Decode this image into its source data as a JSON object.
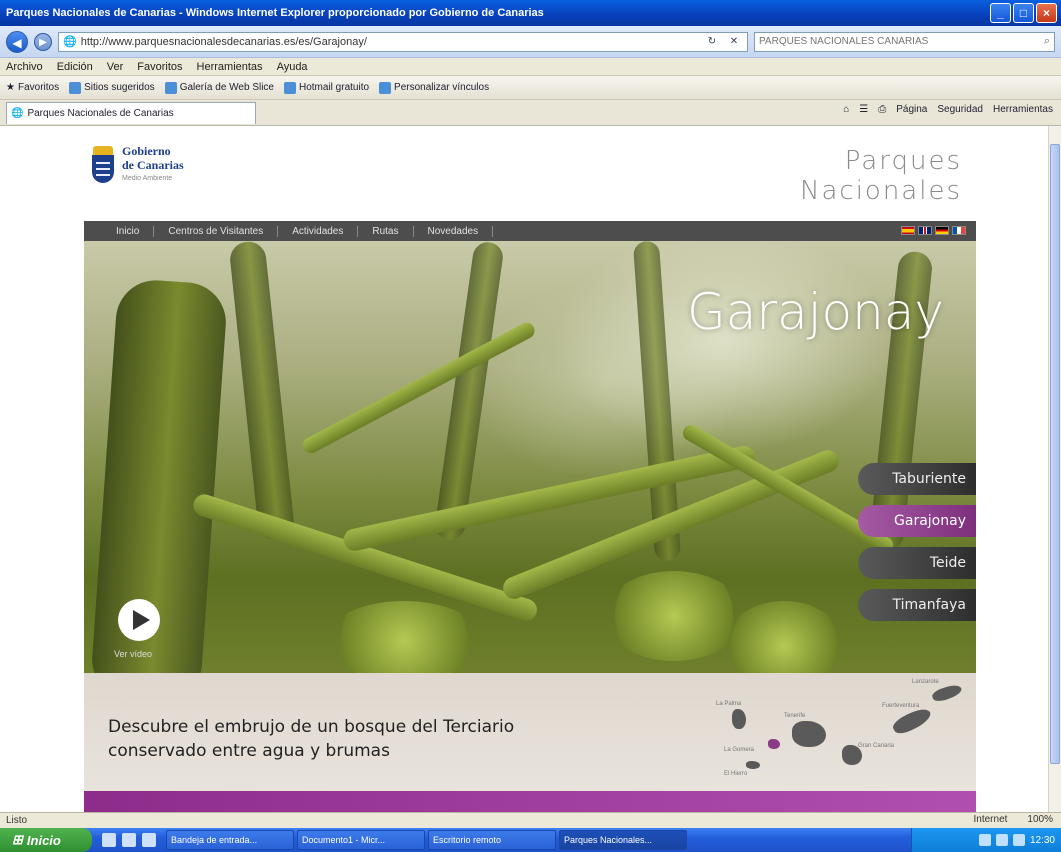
{
  "window": {
    "title": "Parques Nacionales de Canarias - Windows Internet Explorer proporcionado por Gobierno de Canarias"
  },
  "browser": {
    "url": "http://www.parquesnacionalesdecanarias.es/es/Garajonay/",
    "search_placeholder": "PARQUES NACIONALES CANARIAS",
    "menu": [
      "Archivo",
      "Edición",
      "Ver",
      "Favoritos",
      "Herramientas",
      "Ayuda"
    ],
    "favorites_label": "Favoritos",
    "favorites": [
      "Sitios sugeridos",
      "Galería de Web Slice",
      "Hotmail gratuito",
      "Personalizar vínculos"
    ],
    "tab_title": "Parques Nacionales de Canarias",
    "tools": [
      "Página",
      "Seguridad",
      "Herramientas"
    ]
  },
  "site": {
    "logo": {
      "line1": "Gobierno",
      "line2": "de Canarias",
      "sub": "Medio Ambiente"
    },
    "brand": {
      "line1": "Parques",
      "line2": "Nacionales"
    },
    "nav": [
      "Inicio",
      "Centros de Visitantes",
      "Actividades",
      "Rutas",
      "Novedades"
    ],
    "hero_title": "Garajonay",
    "parks": [
      {
        "label": "Taburiente",
        "active": false
      },
      {
        "label": "Garajonay",
        "active": true
      },
      {
        "label": "Teide",
        "active": false
      },
      {
        "label": "Timanfaya",
        "active": false
      }
    ],
    "video_label": "Ver vídeo",
    "tagline_line1": "Descubre el embrujo de un bosque del Terciario",
    "tagline_line2": "conservado entre agua y brumas",
    "islands": [
      "La Palma",
      "La Gomera",
      "El Hierro",
      "Tenerife",
      "Gran Canaria",
      "Fuerteventura",
      "Lanzarote"
    ]
  },
  "status": {
    "text": "Listo",
    "zone": "Internet",
    "zoom": "100%"
  },
  "taskbar": {
    "start": "Inicio",
    "tasks": [
      "Bandeja de entrada...",
      "Documento1 - Micr...",
      "Escritorio remoto",
      "Parques Nacionales..."
    ],
    "clock": "12:30"
  },
  "colors": {
    "accent_purple": "#8d2c8a",
    "nav_gray": "#4d4d4d",
    "brand_gray": "#8a8a8a",
    "gobierno_blue": "#1d3f8c"
  }
}
